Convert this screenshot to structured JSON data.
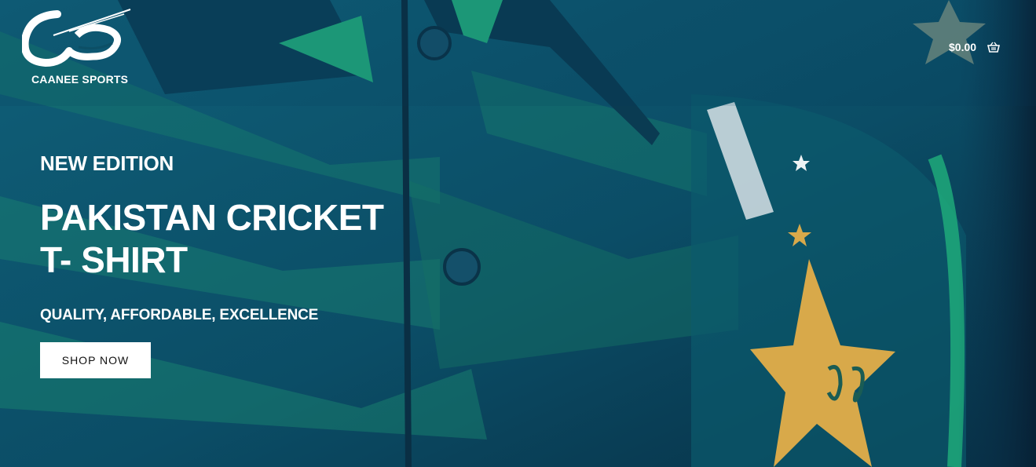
{
  "header": {
    "brand_name": "CAANEE SPORTS",
    "cart_total": "$0.00",
    "cart_icon": "basket-icon"
  },
  "hero": {
    "eyebrow": "NEW EDITION",
    "headline_line1": "PAKISTAN CRICKET",
    "headline_line2": "T- SHIRT",
    "tagline": "QUALITY, AFFORDABLE, EXCELLENCE",
    "cta_label": "SHOP NOW"
  },
  "colors": {
    "background": "#0c4f66",
    "jersey_green": "#1f9a78",
    "star_gold": "#d8a94a",
    "button_bg": "#ffffff",
    "text": "#ffffff"
  }
}
